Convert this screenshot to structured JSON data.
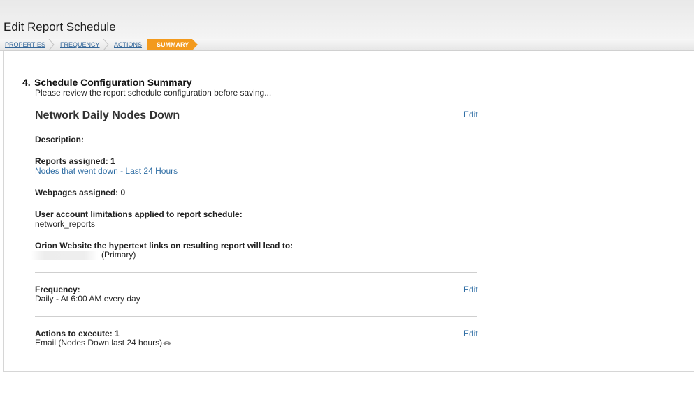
{
  "page": {
    "title": "Edit Report Schedule"
  },
  "wizard": {
    "steps": [
      "PROPERTIES",
      "FREQUENCY",
      "ACTIONS"
    ],
    "active_step": "SUMMARY",
    "active_color": "#f39a1d"
  },
  "summary": {
    "section_number": "4.",
    "section_title": "Schedule Configuration Summary",
    "section_subtitle": "Please review the report schedule configuration before saving...",
    "schedule_name": "Network Daily Nodes Down",
    "edit_label": "Edit",
    "description_label": "Description:",
    "reports_label": "Reports assigned: 1",
    "reports_item": "Nodes that went down - Last 24 Hours",
    "webpages_label": "Webpages assigned: 0",
    "limitations_label": "User account limitations applied to report schedule:",
    "limitations_value": "network_reports",
    "website_label": "Orion Website the hypertext links on resulting report will lead to:",
    "website_primary": "(Primary)",
    "frequency_label": "Frequency:",
    "frequency_value": "Daily - At 6:00 AM every day",
    "actions_label": "Actions to execute: 1",
    "actions_value": "Email (Nodes Down last 24 hours)",
    "link_color": "#2e6da4"
  }
}
